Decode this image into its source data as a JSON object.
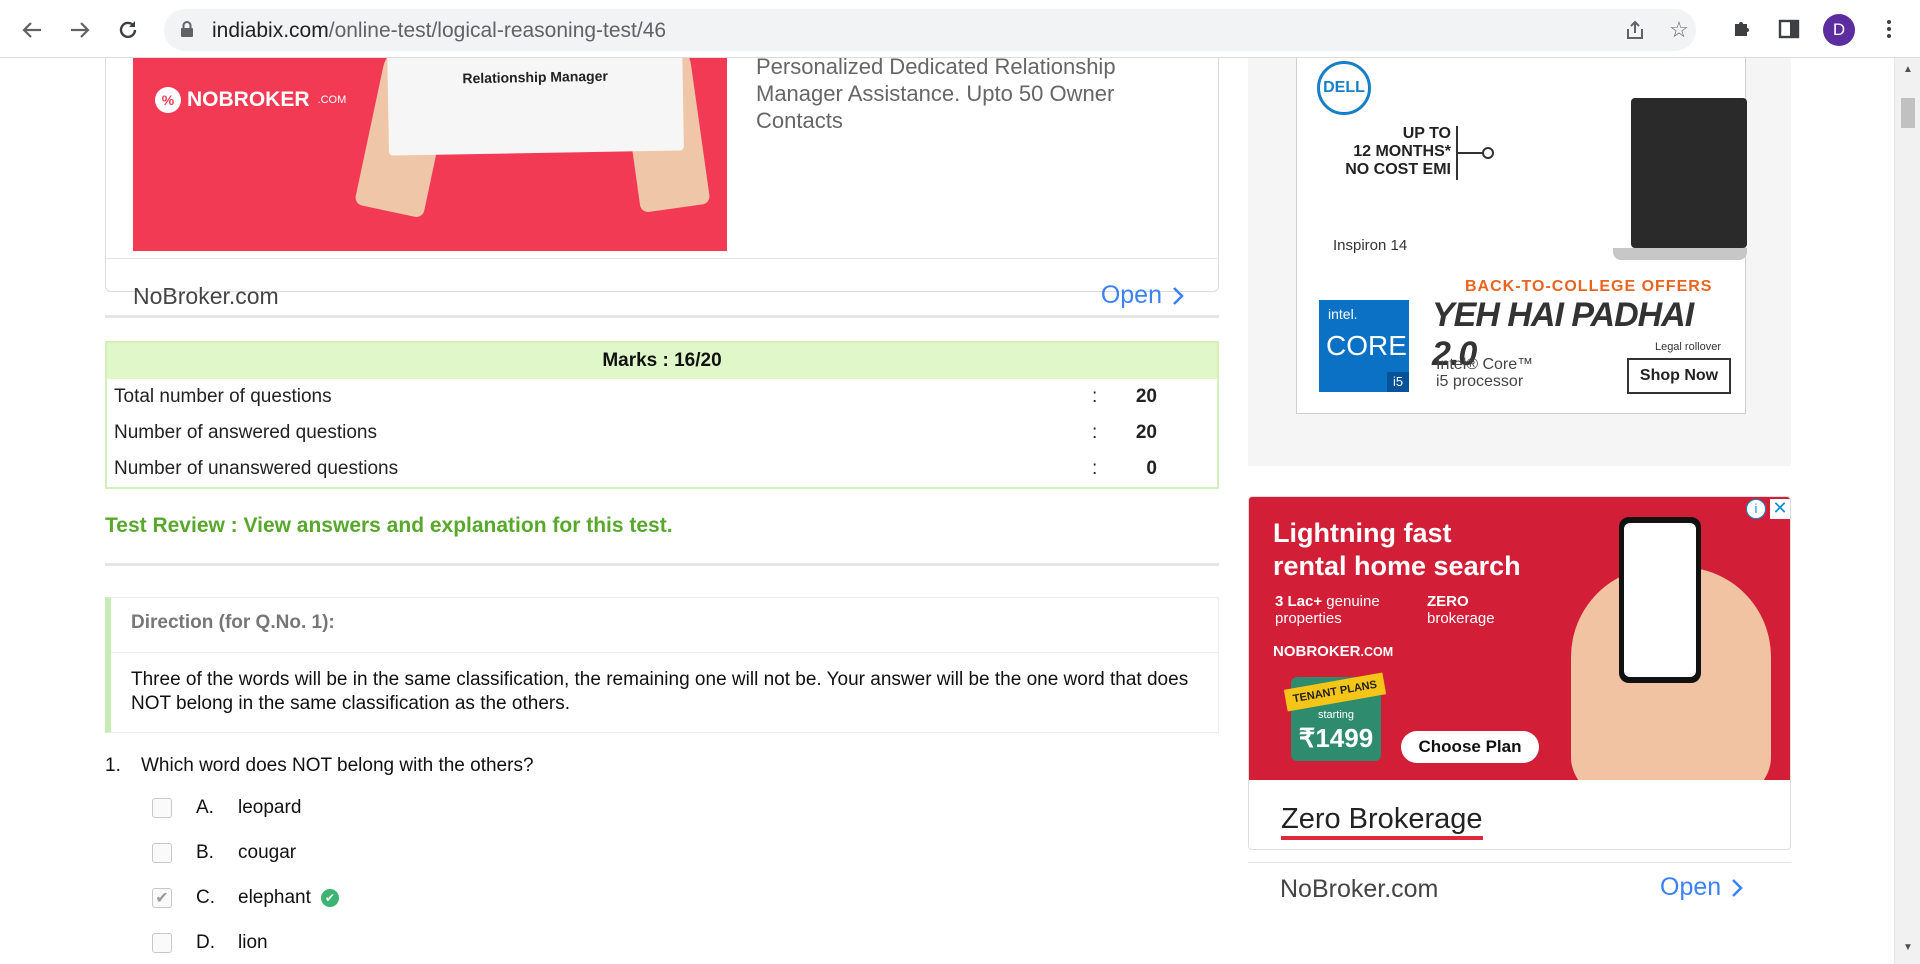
{
  "browser": {
    "url_host": "indiabix.com",
    "url_path": "/online-test/logical-reasoning-test/46",
    "profile_initial": "D"
  },
  "top_ad": {
    "brand": "NOBROKER",
    "brand_suffix": ".COM",
    "sign_text": "Relationship Manager",
    "description": "Personalized Dedicated Relationship Manager Assistance. Upto 50 Owner Contacts",
    "site": "NoBroker.com",
    "open_label": "Open"
  },
  "marks": {
    "heading": "Marks : 16/20",
    "rows": [
      {
        "label": "Total number of questions",
        "colon": ":",
        "value": "20"
      },
      {
        "label": "Number of answered questions",
        "colon": ":",
        "value": "20"
      },
      {
        "label": "Number of unanswered questions",
        "colon": ":",
        "value": "0"
      }
    ]
  },
  "review_link": "Test Review : View answers and explanation for this test.",
  "direction": {
    "title": "Direction (for Q.No. 1):",
    "text": "Three of the words will be in the same classification, the remaining one will not be. Your answer will be the one word that does NOT belong in the same classification as the others."
  },
  "question": {
    "number": "1.",
    "text": "Which word does NOT belong with the others?",
    "options": [
      {
        "letter": "A.",
        "text": "leopard",
        "checked": false,
        "correct": false
      },
      {
        "letter": "B.",
        "text": "cougar",
        "checked": false,
        "correct": false
      },
      {
        "letter": "C.",
        "text": "elephant",
        "checked": true,
        "correct": true
      },
      {
        "letter": "D.",
        "text": "lion",
        "checked": false,
        "correct": false
      }
    ]
  },
  "dell_ad": {
    "logo": "DELL",
    "emi_line1": "UP TO",
    "emi_line2": "12 MONTHS*",
    "emi_line3": "NO COST EMI",
    "model": "Inspiron 14",
    "offer": "BACK-TO-COLLEGE OFFERS",
    "headline": "YEH HAI PADHAI 2.0",
    "intel_brand": "intel.",
    "intel_core": "CORE",
    "intel_tier": "i5",
    "legal": "Legal rollover",
    "processor_line1": "Intel® Core™",
    "processor_line2": "i5 processor",
    "shop_label": "Shop Now"
  },
  "nobroker_ad": {
    "headline_line1": "Lightning fast",
    "headline_line2": "rental home search",
    "feature1_bold": "3 Lac+",
    "feature1_rest": "genuine properties",
    "feature2_bold": "ZERO",
    "feature2_rest": "brokerage",
    "logo": "NOBROKER",
    "logo_suffix": ".COM",
    "tenant_label": "TENANT PLANS",
    "starting_label": "starting",
    "price": "₹1499",
    "choose_label": "Choose Plan",
    "title": "Zero Brokerage",
    "site": "NoBroker.com",
    "open_label": "Open"
  },
  "colors": {
    "accent_green": "#58a82c",
    "link_blue": "#3b82f6",
    "nobroker_red": "#f23a55",
    "dell_blue": "#1580c8"
  }
}
